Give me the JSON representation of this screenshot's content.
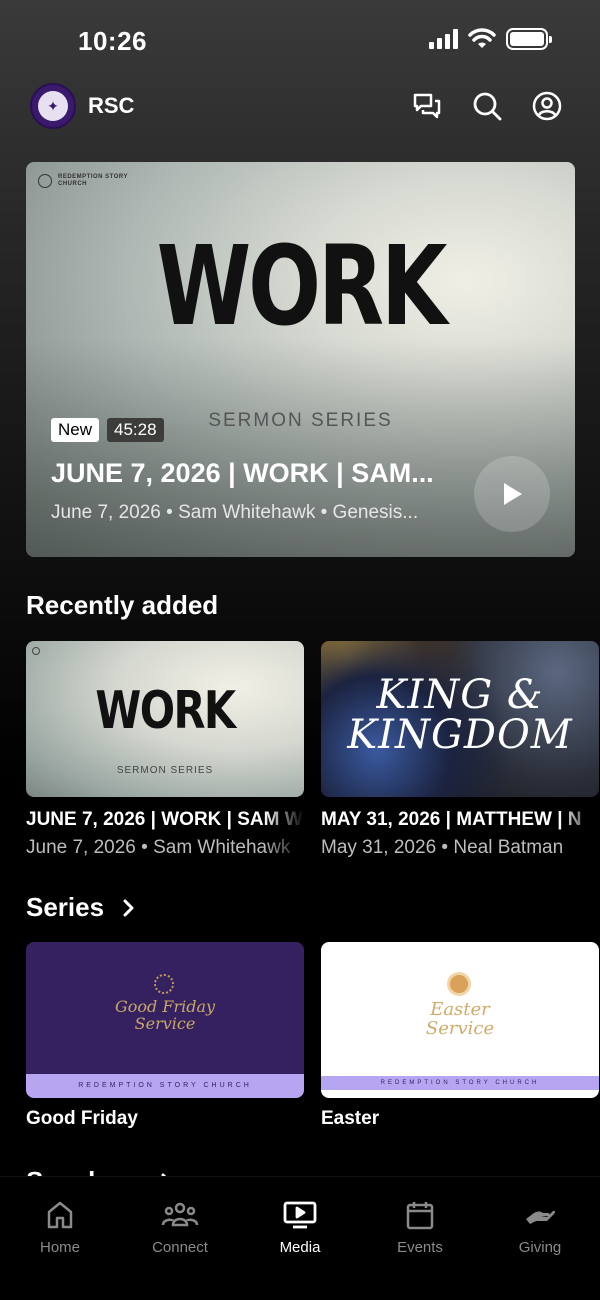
{
  "status": {
    "time": "10:26"
  },
  "header": {
    "brand": "RSC"
  },
  "hero": {
    "brand_text": "REDEMPTION STORY CHURCH",
    "title": "WORK",
    "subtitle": "SERMON SERIES",
    "badge_new": "New",
    "duration": "45:28",
    "episode_title": "JUNE 7, 2026 | WORK | SAM...",
    "meta": "June 7, 2026 • Sam Whitehawk • Genesis..."
  },
  "recent": {
    "title": "Recently added",
    "items": [
      {
        "thumb_title": "WORK",
        "thumb_sub": "SERMON SERIES",
        "title": "JUNE 7, 2026 | WORK | SAM W",
        "meta": "June 7, 2026 • Sam Whitehawk"
      },
      {
        "thumb_title_1": "KING &",
        "thumb_title_2": "KINGDOM",
        "title": "MAY 31, 2026 | MATTHEW | N",
        "meta": "May 31, 2026 • Neal Batman"
      }
    ]
  },
  "series": {
    "title": "Series",
    "items": [
      {
        "thumb_text_1": "Good Friday",
        "thumb_text_2": "Service",
        "band": "REDEMPTION STORY CHURCH",
        "label": "Good Friday"
      },
      {
        "thumb_text_1": "Easter",
        "thumb_text_2": "Service",
        "band": "REDEMPTION STORY CHURCH",
        "label": "Easter"
      }
    ]
  },
  "speakers": {
    "title": "Speakers"
  },
  "tabs": [
    {
      "label": "Home",
      "icon": "home-icon"
    },
    {
      "label": "Connect",
      "icon": "people-icon"
    },
    {
      "label": "Media",
      "icon": "media-icon",
      "active": true
    },
    {
      "label": "Events",
      "icon": "calendar-icon"
    },
    {
      "label": "Giving",
      "icon": "giving-icon"
    }
  ]
}
